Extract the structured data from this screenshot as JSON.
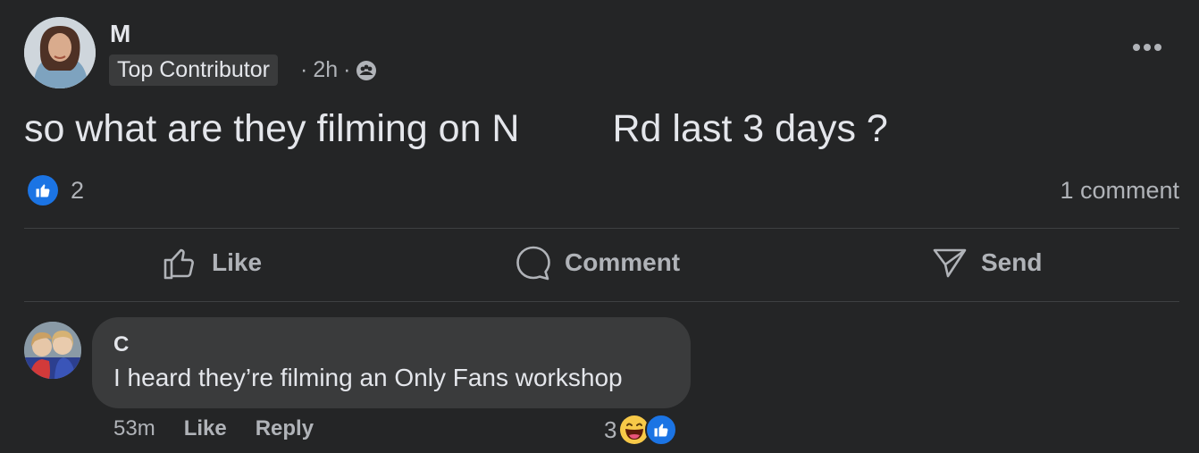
{
  "post": {
    "author": "M",
    "badge": "Top Contributor",
    "time": "2h",
    "separator": "·",
    "audience_icon": "group-icon",
    "text_before": "so what are they filming on N",
    "text_after": "Rd last 3 days ?",
    "reaction_count": "2",
    "comment_count": "1 comment"
  },
  "actions": {
    "like": "Like",
    "comment": "Comment",
    "send": "Send"
  },
  "comment": {
    "author": "C",
    "text": "I heard they’re filming an Only Fans workshop",
    "time": "53m",
    "like": "Like",
    "reply": "Reply",
    "reaction_count": "3"
  },
  "colors": {
    "background": "#242526",
    "bubble": "#3a3b3c",
    "accent": "#1b74e4",
    "secondary_text": "#b0b3b8"
  }
}
